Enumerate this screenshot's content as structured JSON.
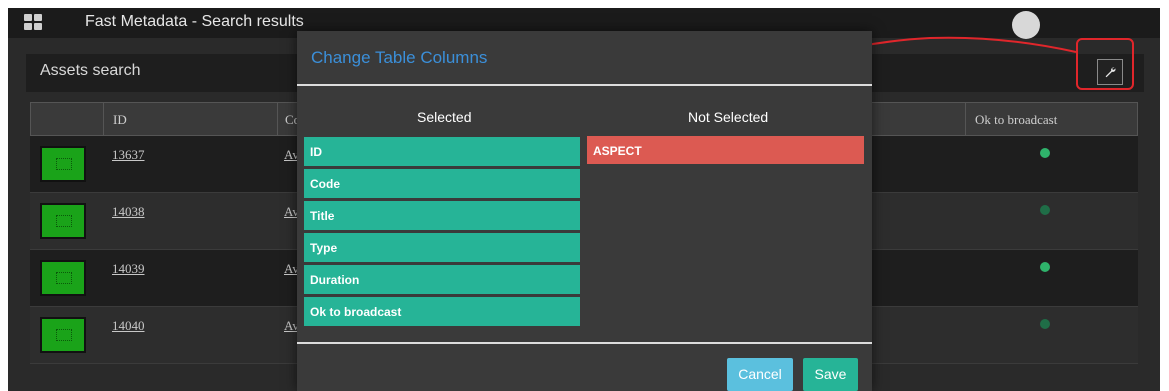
{
  "app": {
    "title": "Fast Metadata - Search results"
  },
  "assets_search": {
    "title": "Assets search"
  },
  "table": {
    "columns": [
      "",
      "ID",
      "Co",
      "Ok to broadcast"
    ],
    "rows": [
      {
        "id": "13637",
        "code": "Av",
        "ok_to_broadcast": true
      },
      {
        "id": "14038",
        "code": "Av",
        "ok_to_broadcast": true
      },
      {
        "id": "14039",
        "code": "Av",
        "ok_to_broadcast": true
      },
      {
        "id": "14040",
        "code": "Av",
        "ok_to_broadcast": true
      }
    ]
  },
  "modal": {
    "title": "Change Table Columns",
    "selected_header": "Selected",
    "not_selected_header": "Not Selected",
    "selected": [
      "ID",
      "Code",
      "Title",
      "Type",
      "Duration",
      "Ok to broadcast"
    ],
    "not_selected": [
      "ASPECT"
    ],
    "cancel_label": "Cancel",
    "save_label": "Save"
  },
  "colors": {
    "selected_item": "#26b497",
    "not_selected_item": "#dc5a52",
    "modal_title": "#3b8fd9",
    "cancel_button": "#5bc0de",
    "save_button": "#26b497",
    "annotation": "#e0262b"
  },
  "icons": {
    "app_menu": "grid-icon",
    "settings_button": "wrench-icon",
    "user": "avatar",
    "ok_status": "check-circle-icon"
  }
}
